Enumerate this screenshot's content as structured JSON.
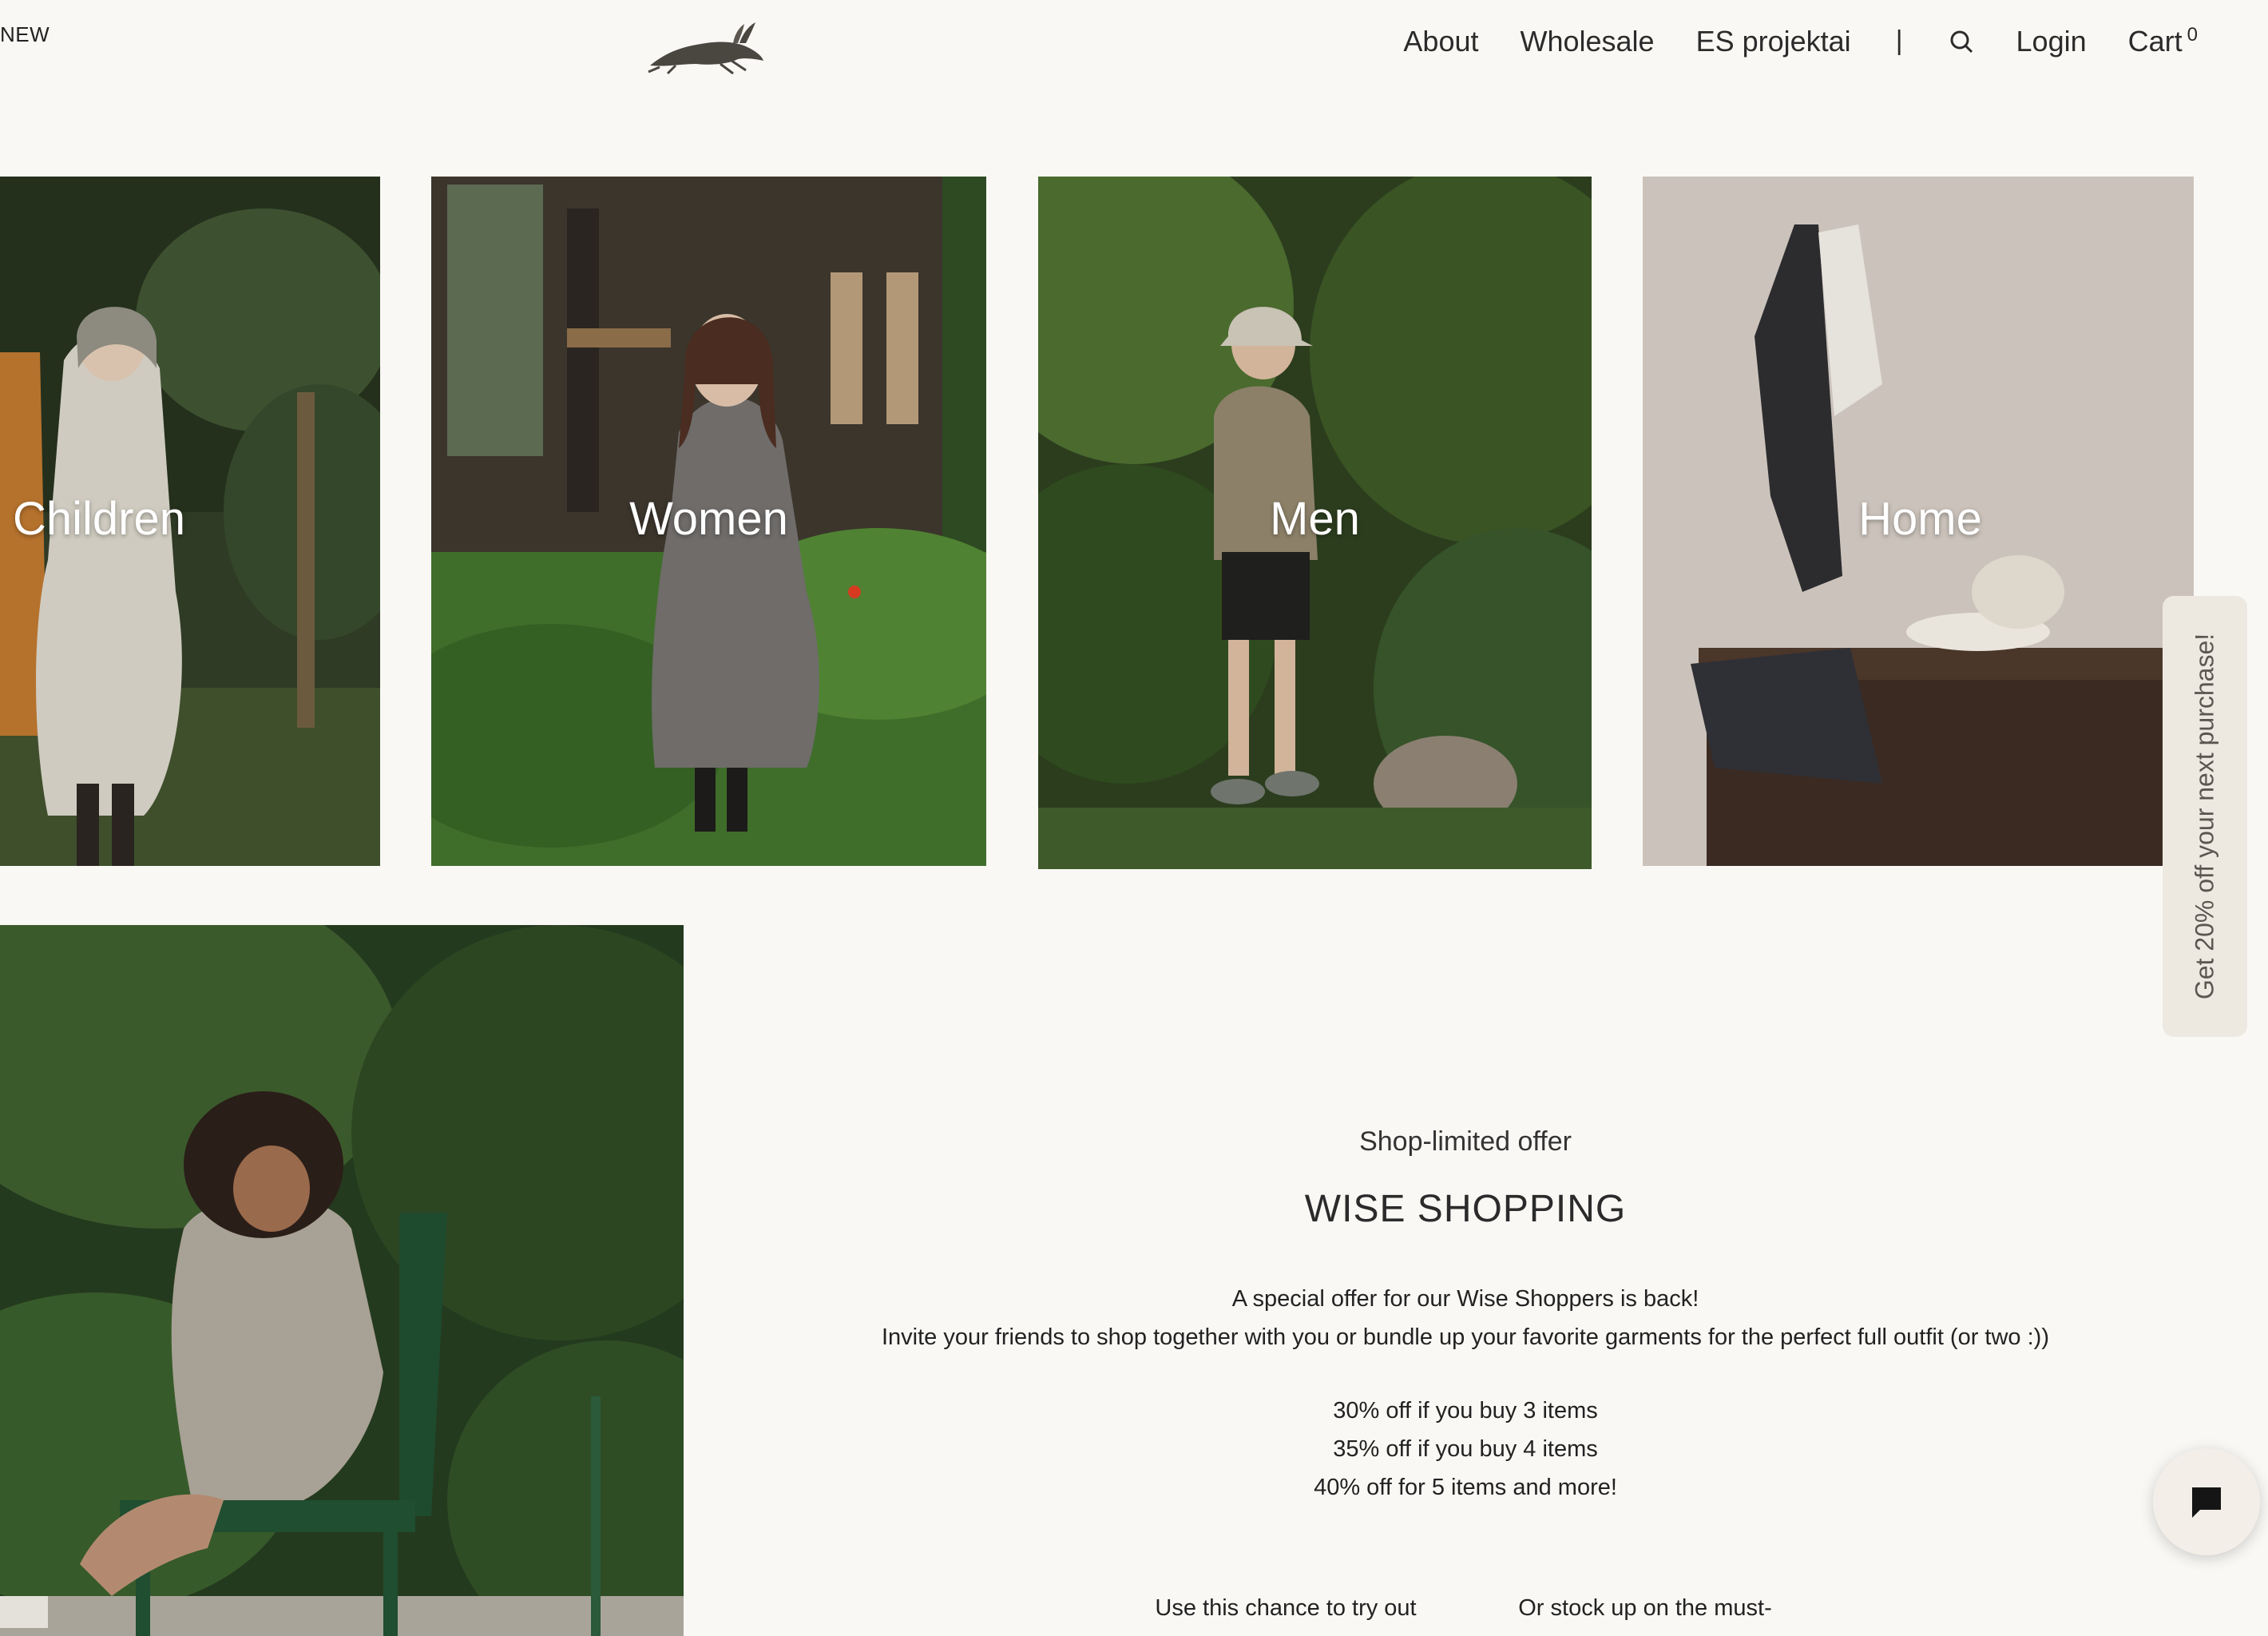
{
  "header": {
    "new_label": "NEW",
    "nav": {
      "about": "About",
      "wholesale": "Wholesale",
      "es_projects": "ES projektai",
      "separator": "|",
      "login": "Login",
      "cart": "Cart",
      "cart_count": "0"
    }
  },
  "categories": [
    {
      "label": "Children"
    },
    {
      "label": "Women"
    },
    {
      "label": "Men"
    },
    {
      "label": "Home"
    }
  ],
  "offer": {
    "kicker": "Shop-limited offer",
    "title": "WISE SHOPPING",
    "line1": "A special offer for our Wise Shoppers is back!",
    "line2": "Invite your friends to shop together with you or bundle up your favorite garments for the perfect full outfit (or two :))",
    "tiers": [
      "30% off if you buy 3 items",
      "35% off if you buy 4 items",
      "40% off for 5 items and more!"
    ],
    "col1": "Use this chance to try out",
    "col2": "Or stock up on the must-"
  },
  "promo_tab": "Get 20% off your next purchase!",
  "colors": {
    "background": "#f9f8f5",
    "text": "#2b2b2b",
    "tab": "#ede9e1"
  }
}
